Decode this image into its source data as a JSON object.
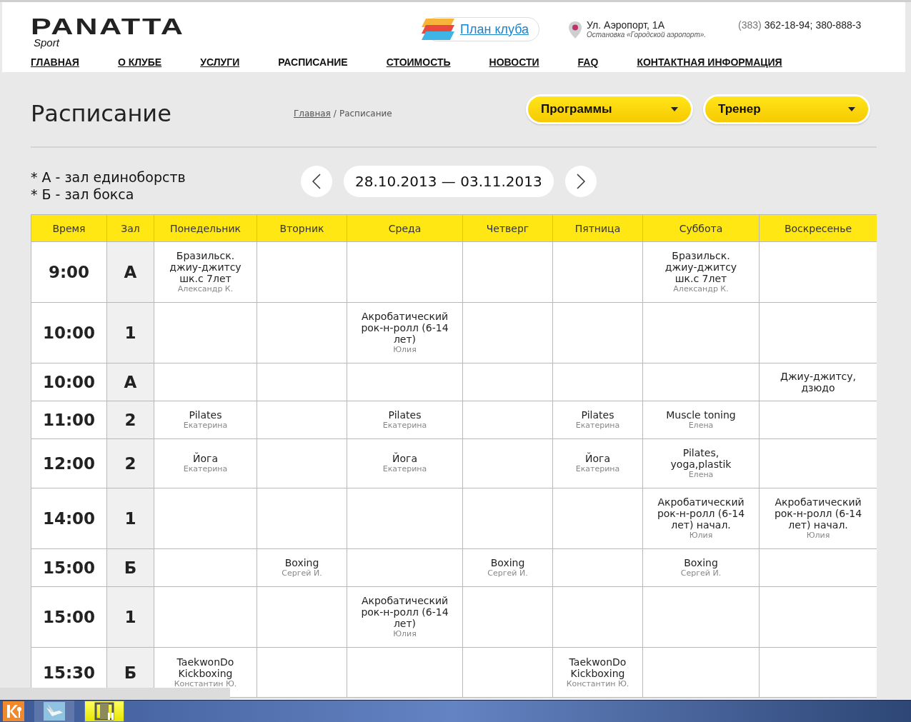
{
  "header": {
    "logo": {
      "name": "PANATTA",
      "tagline": "Sport"
    },
    "plan_link": "План клуба",
    "address": {
      "street": "Ул. Аэропорт, 1А",
      "stop": "Остановка «Городской аэропорт»."
    },
    "phone": {
      "code": "(383)",
      "numbers": "362-18-94; 380-888-3"
    },
    "nav": [
      {
        "label": "ГЛАВНАЯ",
        "selected": false
      },
      {
        "label": "О КЛУБЕ",
        "selected": false
      },
      {
        "label": "УСЛУГИ",
        "selected": false
      },
      {
        "label": "РАСПИСАНИЕ",
        "selected": true
      },
      {
        "label": "СТОИМОСТЬ",
        "selected": false
      },
      {
        "label": "НОВОСТИ",
        "selected": false
      },
      {
        "label": "FAQ",
        "selected": false
      },
      {
        "label": "КОНТАКТНАЯ ИНФОРМАЦИЯ",
        "selected": false
      }
    ]
  },
  "page_title": "Расписание",
  "breadcrumbs": [
    {
      "label": "Главная",
      "kind": "link"
    },
    {
      "label": "/",
      "kind": "separator"
    },
    {
      "label": "Расписание",
      "kind": "current"
    }
  ],
  "filters": [
    {
      "label": "Программы"
    },
    {
      "label": "Тренер"
    }
  ],
  "legend": [
    "* А - зал единоборств",
    "* Б - зал бокса"
  ],
  "week": "28.10.2013 — 03.11.2013",
  "table": {
    "columns": [
      "Время",
      "Зал",
      "Понедельник",
      "Вторник",
      "Среда",
      "Четверг",
      "Пятница",
      "Суббота",
      "Воскресенье"
    ],
    "rows": [
      {
        "cells": [
          "9:00",
          "А",
          {
            "title": "Бразильск. джиу-джитсу шк.с 7лет",
            "trainer": "Александр К."
          },
          "",
          "",
          "",
          "",
          {
            "title": "Бразильск. джиу-джитсу шк.с 7лет",
            "trainer": "Александр К."
          },
          ""
        ]
      },
      {
        "cells": [
          "10:00",
          "1",
          "",
          "",
          {
            "title": "Акробатический рок-н-ролл (6-14 лет)",
            "trainer": "Юлия"
          },
          "",
          "",
          "",
          ""
        ]
      },
      {
        "cells": [
          "10:00",
          "А",
          "",
          "",
          "",
          "",
          "",
          "",
          {
            "title": "Джиу-джитсу, дзюдо"
          }
        ]
      },
      {
        "cells": [
          "11:00",
          "2",
          {
            "title": "Pilates",
            "trainer": "Екатерина"
          },
          "",
          {
            "title": "Pilates",
            "trainer": "Екатерина"
          },
          "",
          {
            "title": "Pilates",
            "trainer": "Екатерина"
          },
          {
            "title": "Muscle toning",
            "trainer": "Елена"
          },
          ""
        ]
      },
      {
        "cells": [
          "12:00",
          "2",
          {
            "title": "Йога",
            "trainer": "Екатерина"
          },
          "",
          {
            "title": "Йога",
            "trainer": "Екатерина"
          },
          "",
          {
            "title": "Йога",
            "trainer": "Екатерина"
          },
          {
            "title": "Pilates, yoga,plastik",
            "trainer": "Елена"
          },
          ""
        ]
      },
      {
        "cells": [
          "14:00",
          "1",
          "",
          "",
          "",
          "",
          "",
          {
            "title": "Акробатический рок-н-ролл (6-14 лет) начал.",
            "trainer": "Юлия"
          },
          {
            "title": "Акробатический рок-н-ролл (6-14 лет) начал.",
            "trainer": "Юлия"
          }
        ]
      },
      {
        "cells": [
          "15:00",
          "Б",
          "",
          {
            "title": "Boxing",
            "trainer": "Сергей И."
          },
          "",
          {
            "title": "Boxing",
            "trainer": "Сергей И."
          },
          "",
          {
            "title": "Boxing",
            "trainer": "Сергей И."
          },
          ""
        ]
      },
      {
        "cells": [
          "15:00",
          "1",
          "",
          "",
          {
            "title": "Акробатический рок-н-ролл (6-14 лет)",
            "trainer": "Юлия"
          },
          "",
          "",
          "",
          ""
        ]
      },
      {
        "cells": [
          "15:30",
          "Б",
          {
            "title": "TaekwonDo Kickboxing",
            "trainer": "Константин Ю."
          },
          "",
          "",
          "",
          {
            "title": "TaekwonDo Kickboxing",
            "trainer": "Константин Ю."
          },
          "",
          ""
        ]
      }
    ]
  },
  "taskbar": {
    "items": [
      {
        "kind": "k"
      },
      {
        "kind": "bird"
      },
      {
        "kind": "film",
        "selected": true
      }
    ]
  }
}
